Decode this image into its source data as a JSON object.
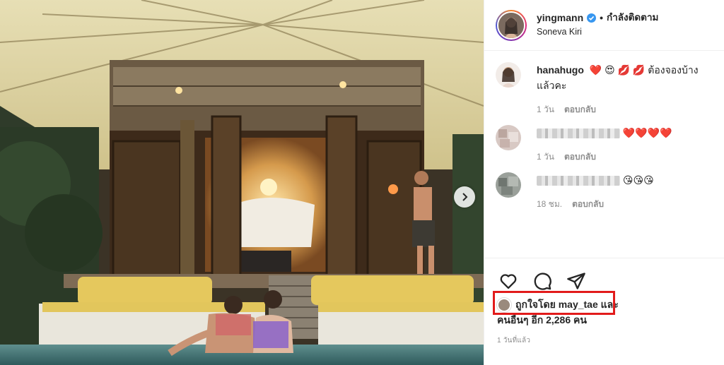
{
  "post": {
    "author": "yingmann",
    "verified": true,
    "follow_state": "กำลังติดตาม",
    "location": "Soneva Kiri"
  },
  "comments": [
    {
      "username": "hanahugo",
      "text": "❤️ 😍 💋 💋  ต้องจองบ้าง แล้วคะ",
      "age": "1 วัน",
      "reply_label": "ตอบกลับ",
      "blurred": false
    },
    {
      "username": "",
      "text": "❤️❤️❤️❤️",
      "age": "1 วัน",
      "reply_label": "ตอบกลับ",
      "blurred": true
    },
    {
      "username": "",
      "text": "😘😘😘",
      "age": "18 ชม.",
      "reply_label": "ตอบกลับ",
      "blurred": true
    }
  ],
  "actions": {
    "like_icon": "heart-icon",
    "comment_icon": "comment-icon",
    "share_icon": "paper-plane-icon"
  },
  "likes": {
    "prefix": "ถูกใจโดย",
    "user": "may_tae",
    "middle": "และ",
    "others_label": "คนอื่นๆ อีก 2,286 คน"
  },
  "timestamp": "1 วันที่แล้ว",
  "colors": {
    "verified": "#3897f0",
    "highlight_box": "#e21b1b",
    "meta_text": "#8e8e8e"
  }
}
